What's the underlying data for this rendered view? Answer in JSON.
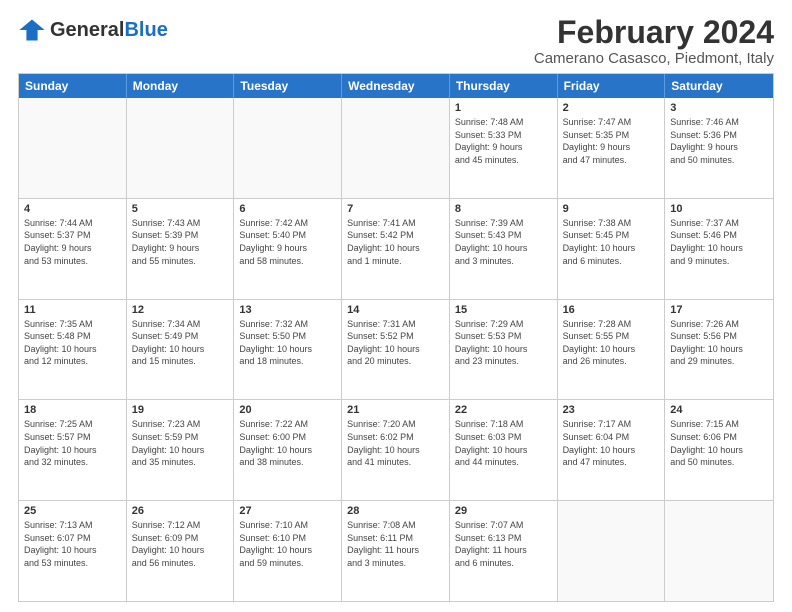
{
  "header": {
    "logo_general": "General",
    "logo_blue": "Blue",
    "month_title": "February 2024",
    "subtitle": "Camerano Casasco, Piedmont, Italy"
  },
  "day_headers": [
    "Sunday",
    "Monday",
    "Tuesday",
    "Wednesday",
    "Thursday",
    "Friday",
    "Saturday"
  ],
  "weeks": [
    [
      {
        "day": "",
        "info": ""
      },
      {
        "day": "",
        "info": ""
      },
      {
        "day": "",
        "info": ""
      },
      {
        "day": "",
        "info": ""
      },
      {
        "day": "1",
        "info": "Sunrise: 7:48 AM\nSunset: 5:33 PM\nDaylight: 9 hours\nand 45 minutes."
      },
      {
        "day": "2",
        "info": "Sunrise: 7:47 AM\nSunset: 5:35 PM\nDaylight: 9 hours\nand 47 minutes."
      },
      {
        "day": "3",
        "info": "Sunrise: 7:46 AM\nSunset: 5:36 PM\nDaylight: 9 hours\nand 50 minutes."
      }
    ],
    [
      {
        "day": "4",
        "info": "Sunrise: 7:44 AM\nSunset: 5:37 PM\nDaylight: 9 hours\nand 53 minutes."
      },
      {
        "day": "5",
        "info": "Sunrise: 7:43 AM\nSunset: 5:39 PM\nDaylight: 9 hours\nand 55 minutes."
      },
      {
        "day": "6",
        "info": "Sunrise: 7:42 AM\nSunset: 5:40 PM\nDaylight: 9 hours\nand 58 minutes."
      },
      {
        "day": "7",
        "info": "Sunrise: 7:41 AM\nSunset: 5:42 PM\nDaylight: 10 hours\nand 1 minute."
      },
      {
        "day": "8",
        "info": "Sunrise: 7:39 AM\nSunset: 5:43 PM\nDaylight: 10 hours\nand 3 minutes."
      },
      {
        "day": "9",
        "info": "Sunrise: 7:38 AM\nSunset: 5:45 PM\nDaylight: 10 hours\nand 6 minutes."
      },
      {
        "day": "10",
        "info": "Sunrise: 7:37 AM\nSunset: 5:46 PM\nDaylight: 10 hours\nand 9 minutes."
      }
    ],
    [
      {
        "day": "11",
        "info": "Sunrise: 7:35 AM\nSunset: 5:48 PM\nDaylight: 10 hours\nand 12 minutes."
      },
      {
        "day": "12",
        "info": "Sunrise: 7:34 AM\nSunset: 5:49 PM\nDaylight: 10 hours\nand 15 minutes."
      },
      {
        "day": "13",
        "info": "Sunrise: 7:32 AM\nSunset: 5:50 PM\nDaylight: 10 hours\nand 18 minutes."
      },
      {
        "day": "14",
        "info": "Sunrise: 7:31 AM\nSunset: 5:52 PM\nDaylight: 10 hours\nand 20 minutes."
      },
      {
        "day": "15",
        "info": "Sunrise: 7:29 AM\nSunset: 5:53 PM\nDaylight: 10 hours\nand 23 minutes."
      },
      {
        "day": "16",
        "info": "Sunrise: 7:28 AM\nSunset: 5:55 PM\nDaylight: 10 hours\nand 26 minutes."
      },
      {
        "day": "17",
        "info": "Sunrise: 7:26 AM\nSunset: 5:56 PM\nDaylight: 10 hours\nand 29 minutes."
      }
    ],
    [
      {
        "day": "18",
        "info": "Sunrise: 7:25 AM\nSunset: 5:57 PM\nDaylight: 10 hours\nand 32 minutes."
      },
      {
        "day": "19",
        "info": "Sunrise: 7:23 AM\nSunset: 5:59 PM\nDaylight: 10 hours\nand 35 minutes."
      },
      {
        "day": "20",
        "info": "Sunrise: 7:22 AM\nSunset: 6:00 PM\nDaylight: 10 hours\nand 38 minutes."
      },
      {
        "day": "21",
        "info": "Sunrise: 7:20 AM\nSunset: 6:02 PM\nDaylight: 10 hours\nand 41 minutes."
      },
      {
        "day": "22",
        "info": "Sunrise: 7:18 AM\nSunset: 6:03 PM\nDaylight: 10 hours\nand 44 minutes."
      },
      {
        "day": "23",
        "info": "Sunrise: 7:17 AM\nSunset: 6:04 PM\nDaylight: 10 hours\nand 47 minutes."
      },
      {
        "day": "24",
        "info": "Sunrise: 7:15 AM\nSunset: 6:06 PM\nDaylight: 10 hours\nand 50 minutes."
      }
    ],
    [
      {
        "day": "25",
        "info": "Sunrise: 7:13 AM\nSunset: 6:07 PM\nDaylight: 10 hours\nand 53 minutes."
      },
      {
        "day": "26",
        "info": "Sunrise: 7:12 AM\nSunset: 6:09 PM\nDaylight: 10 hours\nand 56 minutes."
      },
      {
        "day": "27",
        "info": "Sunrise: 7:10 AM\nSunset: 6:10 PM\nDaylight: 10 hours\nand 59 minutes."
      },
      {
        "day": "28",
        "info": "Sunrise: 7:08 AM\nSunset: 6:11 PM\nDaylight: 11 hours\nand 3 minutes."
      },
      {
        "day": "29",
        "info": "Sunrise: 7:07 AM\nSunset: 6:13 PM\nDaylight: 11 hours\nand 6 minutes."
      },
      {
        "day": "",
        "info": ""
      },
      {
        "day": "",
        "info": ""
      }
    ]
  ]
}
